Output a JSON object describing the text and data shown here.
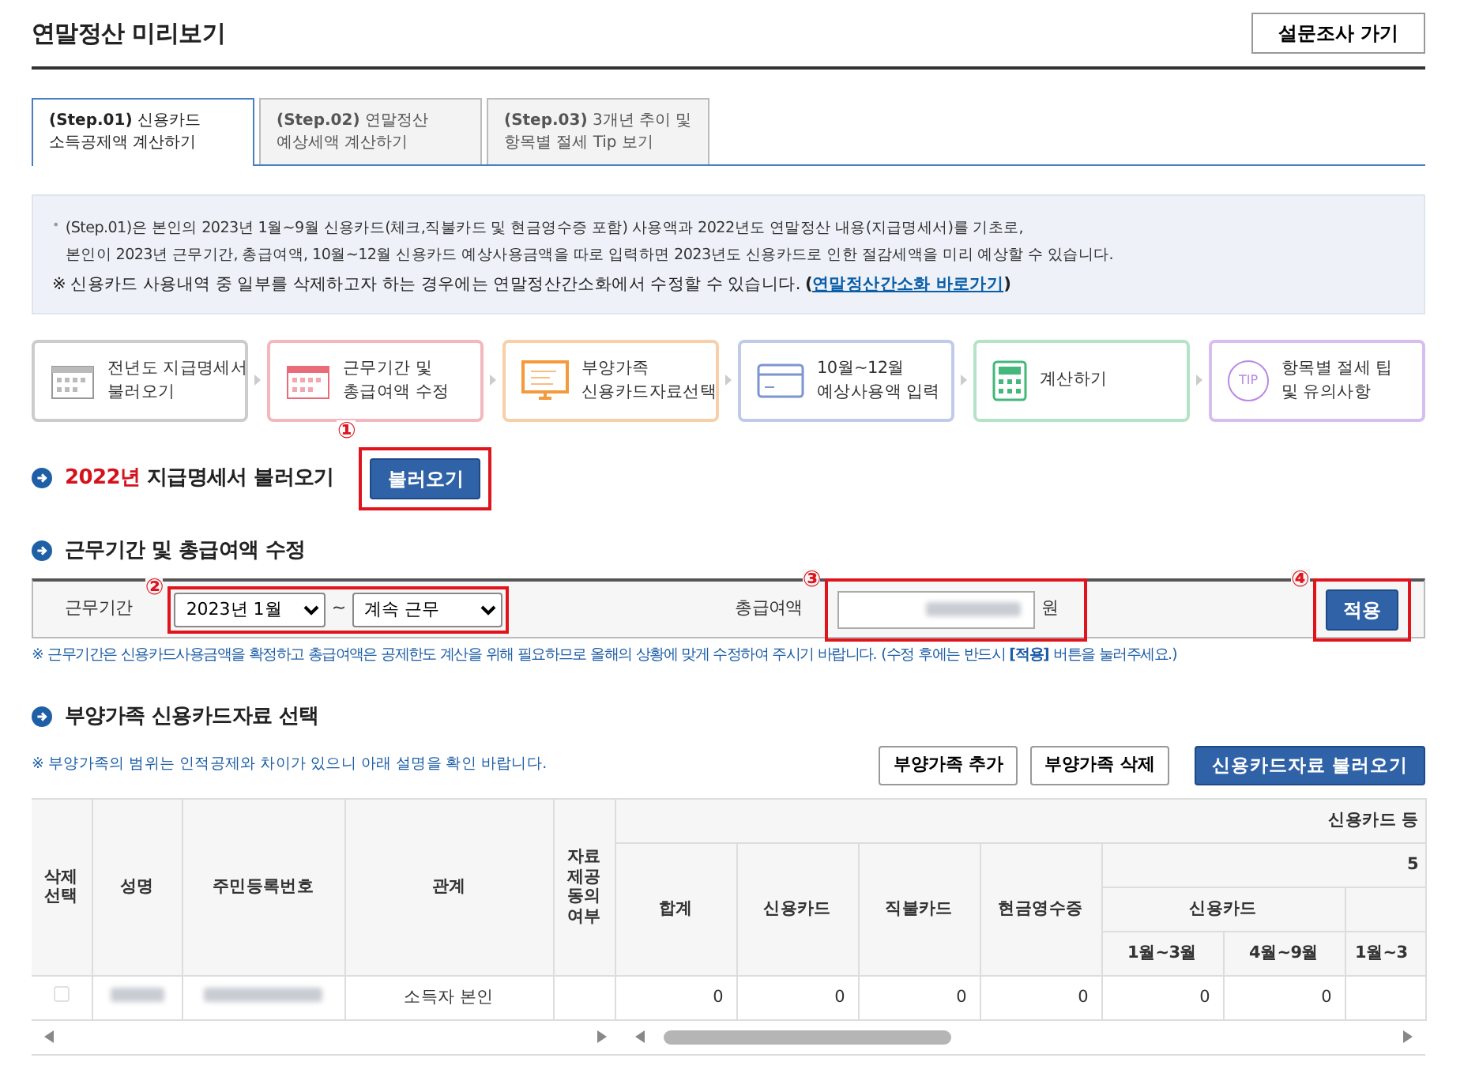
{
  "header": {
    "title": "연말정산 미리보기",
    "survey_button": "설문조사 가기"
  },
  "tabs": [
    {
      "label": "**(Step.01)** 신용카드",
      "label2": "소득공제액 계산하기",
      "selected": true
    },
    {
      "label": "**(Step.02)** 연말정산",
      "label2": "예상세액 계산하기",
      "selected": false
    },
    {
      "label": "**(Step.03)** 3개년 추이 및",
      "label2": "항목별 절세 Tip 보기",
      "selected": false
    }
  ],
  "info": {
    "bullet": "•",
    "lines": [
      "(Step.01)은 본인의 2023년 1월~9월 신용카드(체크,직불카드 및 현금영수증 포함) 사용액과 2022년도 연말정산 내용(지급명세서)를 기초로,",
      "본인이 2023년 근무기간, 총급여액, 10월~12월 신용카드 예상사용금액을 따로 입력하면 2023년도 신용카드로 인한 절감세액을 미리 예상할 수 있습니다."
    ],
    "note_prefix": "※ 신용카드 사용내역 중 일부를 삭제하고자 하는 경우에는 연말정산간소화에서 수정할 수 있습니다. **(**",
    "note_link": "연말정산간소화 바로가기",
    "note_suffix": "**)**"
  },
  "steps": [
    {
      "kind": "calendar-grey",
      "line1": "전년도 지급명세서",
      "line2": "불러오기",
      "color": "#cccccc"
    },
    {
      "kind": "calendar",
      "line1": "근무기간 및",
      "line2": "총급여액 수정",
      "color": "#f2b8bd"
    },
    {
      "kind": "monitor",
      "line1": "부양가족",
      "line2": "신용카드자료선택",
      "color": "#f7cfa8"
    },
    {
      "kind": "card",
      "line1": "10월~12월",
      "line2": "예상사용액 입력",
      "color": "#bfcbe8"
    },
    {
      "kind": "calculator",
      "line1": "계산하기",
      "color": "#b5e3c8"
    },
    {
      "kind": "tip",
      "icon_text": "TIP",
      "line1": "항목별 절세 팁",
      "line2": "및 유의사항",
      "color": "#d7bdf0"
    }
  ],
  "section_load": {
    "year": "2022년",
    "title": "지급명세서 불러오기",
    "button": "불러오기",
    "callout": "①"
  },
  "section_period": {
    "title": "근무기간 및 총급여액 수정",
    "period_label": "근무기간",
    "start": "2023년 1월",
    "separator": "~",
    "end": "계속 근무",
    "period_callout": "②",
    "salary_label": "총급여액",
    "salary_callout": "③",
    "unit": "원",
    "apply_button": "적용",
    "apply_callout": "④",
    "hint": "※ 근무기간은 신용카드사용금액을 확정하고 총급여액은 공제한도 계산을 위해 필요하므로 올해의 상황에 맞게 수정하여 주시기 바랍니다. (수정 후에는 반드시 **[적용]** 버튼을 눌러주세요.)"
  },
  "section_family": {
    "title": "부양가족 신용카드자료 선택",
    "hint": "※ 부양가족의 범위는 인적공제와 차이가 있으니 아래 설명을 확인 바랍니다.",
    "buttons": [
      "부양가족 추가",
      "부양가족 삭제"
    ],
    "primary_button": "신용카드자료 불러오기"
  },
  "table": {
    "fixed_columns": [
      "삭제\n선택",
      "성명",
      "주민등록번호",
      "관계",
      "자료\n제공\n동의\n여부"
    ],
    "group_header": "신용카드 등",
    "sum_columns": [
      "합계",
      "신용카드",
      "직불카드",
      "현금영수증"
    ],
    "column_group_cut": "5",
    "sub_group": "신용카드",
    "period_columns": [
      "1월~3월",
      "4월~9월",
      "1월~3"
    ],
    "rows": [
      {
        "checked": false,
        "relation": "소득자 본인",
        "values": [
          "0",
          "0",
          "0",
          "0",
          "0",
          "0"
        ]
      }
    ]
  }
}
